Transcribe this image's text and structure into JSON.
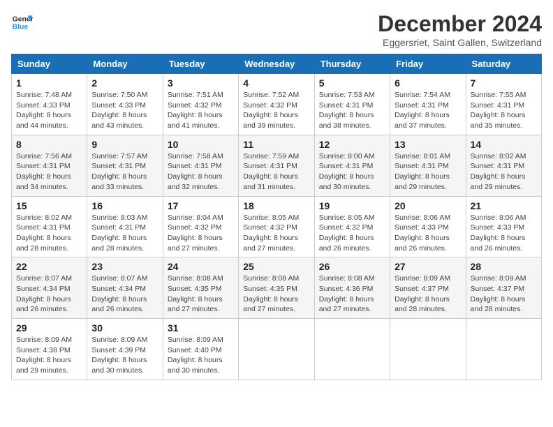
{
  "header": {
    "logo_line1": "General",
    "logo_line2": "Blue",
    "month_title": "December 2024",
    "location": "Eggersriet, Saint Gallen, Switzerland"
  },
  "weekdays": [
    "Sunday",
    "Monday",
    "Tuesday",
    "Wednesday",
    "Thursday",
    "Friday",
    "Saturday"
  ],
  "weeks": [
    [
      {
        "day": "1",
        "sunrise": "7:48 AM",
        "sunset": "4:33 PM",
        "daylight": "8 hours and 44 minutes."
      },
      {
        "day": "2",
        "sunrise": "7:50 AM",
        "sunset": "4:33 PM",
        "daylight": "8 hours and 43 minutes."
      },
      {
        "day": "3",
        "sunrise": "7:51 AM",
        "sunset": "4:32 PM",
        "daylight": "8 hours and 41 minutes."
      },
      {
        "day": "4",
        "sunrise": "7:52 AM",
        "sunset": "4:32 PM",
        "daylight": "8 hours and 39 minutes."
      },
      {
        "day": "5",
        "sunrise": "7:53 AM",
        "sunset": "4:31 PM",
        "daylight": "8 hours and 38 minutes."
      },
      {
        "day": "6",
        "sunrise": "7:54 AM",
        "sunset": "4:31 PM",
        "daylight": "8 hours and 37 minutes."
      },
      {
        "day": "7",
        "sunrise": "7:55 AM",
        "sunset": "4:31 PM",
        "daylight": "8 hours and 35 minutes."
      }
    ],
    [
      {
        "day": "8",
        "sunrise": "7:56 AM",
        "sunset": "4:31 PM",
        "daylight": "8 hours and 34 minutes."
      },
      {
        "day": "9",
        "sunrise": "7:57 AM",
        "sunset": "4:31 PM",
        "daylight": "8 hours and 33 minutes."
      },
      {
        "day": "10",
        "sunrise": "7:58 AM",
        "sunset": "4:31 PM",
        "daylight": "8 hours and 32 minutes."
      },
      {
        "day": "11",
        "sunrise": "7:59 AM",
        "sunset": "4:31 PM",
        "daylight": "8 hours and 31 minutes."
      },
      {
        "day": "12",
        "sunrise": "8:00 AM",
        "sunset": "4:31 PM",
        "daylight": "8 hours and 30 minutes."
      },
      {
        "day": "13",
        "sunrise": "8:01 AM",
        "sunset": "4:31 PM",
        "daylight": "8 hours and 29 minutes."
      },
      {
        "day": "14",
        "sunrise": "8:02 AM",
        "sunset": "4:31 PM",
        "daylight": "8 hours and 29 minutes."
      }
    ],
    [
      {
        "day": "15",
        "sunrise": "8:02 AM",
        "sunset": "4:31 PM",
        "daylight": "8 hours and 28 minutes."
      },
      {
        "day": "16",
        "sunrise": "8:03 AM",
        "sunset": "4:31 PM",
        "daylight": "8 hours and 28 minutes."
      },
      {
        "day": "17",
        "sunrise": "8:04 AM",
        "sunset": "4:32 PM",
        "daylight": "8 hours and 27 minutes."
      },
      {
        "day": "18",
        "sunrise": "8:05 AM",
        "sunset": "4:32 PM",
        "daylight": "8 hours and 27 minutes."
      },
      {
        "day": "19",
        "sunrise": "8:05 AM",
        "sunset": "4:32 PM",
        "daylight": "8 hours and 26 minutes."
      },
      {
        "day": "20",
        "sunrise": "8:06 AM",
        "sunset": "4:33 PM",
        "daylight": "8 hours and 26 minutes."
      },
      {
        "day": "21",
        "sunrise": "8:06 AM",
        "sunset": "4:33 PM",
        "daylight": "8 hours and 26 minutes."
      }
    ],
    [
      {
        "day": "22",
        "sunrise": "8:07 AM",
        "sunset": "4:34 PM",
        "daylight": "8 hours and 26 minutes."
      },
      {
        "day": "23",
        "sunrise": "8:07 AM",
        "sunset": "4:34 PM",
        "daylight": "8 hours and 26 minutes."
      },
      {
        "day": "24",
        "sunrise": "8:08 AM",
        "sunset": "4:35 PM",
        "daylight": "8 hours and 27 minutes."
      },
      {
        "day": "25",
        "sunrise": "8:08 AM",
        "sunset": "4:35 PM",
        "daylight": "8 hours and 27 minutes."
      },
      {
        "day": "26",
        "sunrise": "8:08 AM",
        "sunset": "4:36 PM",
        "daylight": "8 hours and 27 minutes."
      },
      {
        "day": "27",
        "sunrise": "8:09 AM",
        "sunset": "4:37 PM",
        "daylight": "8 hours and 28 minutes."
      },
      {
        "day": "28",
        "sunrise": "8:09 AM",
        "sunset": "4:37 PM",
        "daylight": "8 hours and 28 minutes."
      }
    ],
    [
      {
        "day": "29",
        "sunrise": "8:09 AM",
        "sunset": "4:38 PM",
        "daylight": "8 hours and 29 minutes."
      },
      {
        "day": "30",
        "sunrise": "8:09 AM",
        "sunset": "4:39 PM",
        "daylight": "8 hours and 30 minutes."
      },
      {
        "day": "31",
        "sunrise": "8:09 AM",
        "sunset": "4:40 PM",
        "daylight": "8 hours and 30 minutes."
      },
      null,
      null,
      null,
      null
    ]
  ]
}
